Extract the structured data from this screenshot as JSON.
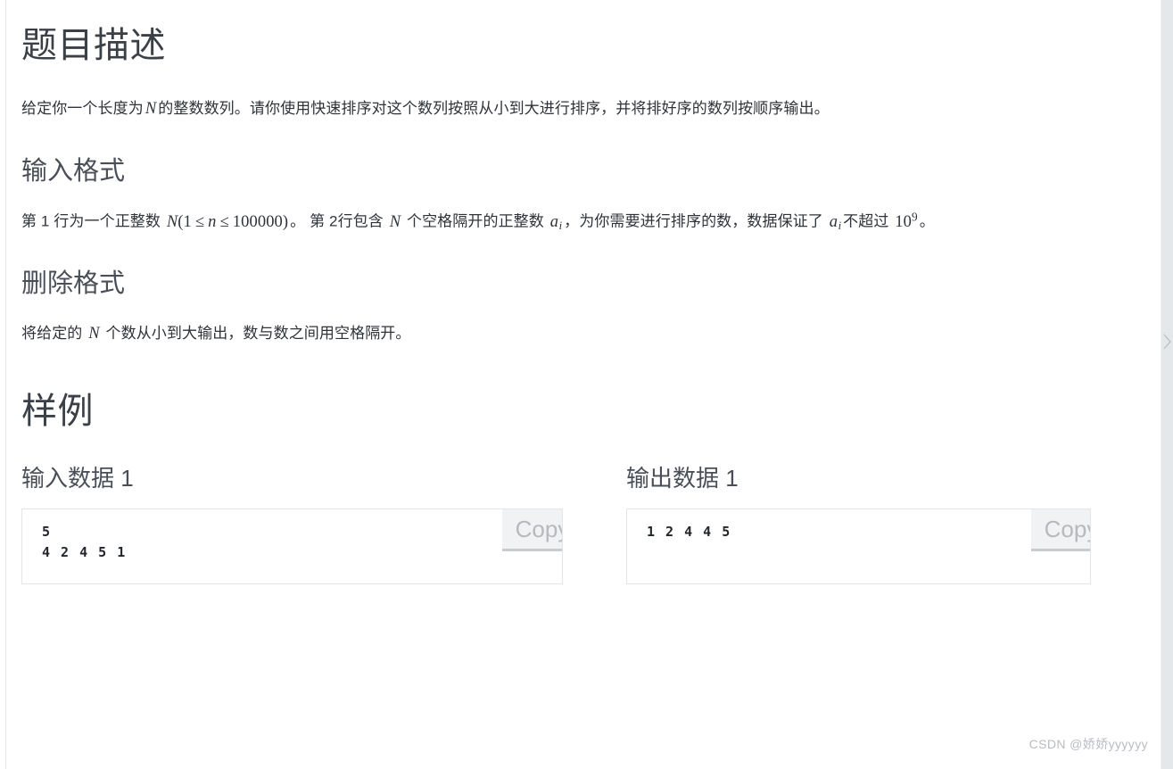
{
  "document": {
    "title": "题目描述",
    "description": {
      "prefix": "给定你一个长度为",
      "var_n": "N",
      "suffix": "的整数数列。请你使用快速排序对这个数列按照从小到大进行排序，并将排好序的数列按顺序输出。"
    },
    "sections": [
      {
        "heading": "输入格式",
        "text_1": "第 1 行为一个正整数 ",
        "math_1": "N(1 ≤ n ≤ 100000)",
        "text_2": "。 第 2行包含 ",
        "math_2": "N",
        "text_3": " 个空格隔开的正整数 ",
        "math_3": "a_i",
        "text_4": "，为你需要进行排序的数，数据保证了 ",
        "math_4": "a_i",
        "text_5": "不超过 ",
        "math_5": "10^9",
        "text_6": "。"
      },
      {
        "heading": "删除格式",
        "text_1": "将给定的 ",
        "math_1": "N",
        "text_2": " 个数从小到大输出，数与数之间用空格隔开。"
      }
    ],
    "sample": {
      "title": "样例",
      "input": {
        "heading": "输入数据 1",
        "code": "5\n4 2 4 5 1",
        "copy_label": "Copy"
      },
      "output": {
        "heading": "输出数据 1",
        "code": "1 2 4 4 5",
        "copy_label": "Copy"
      }
    },
    "math_symbols": {
      "n_upper": "N",
      "n_lower": "n",
      "one": "1",
      "limit": "100000",
      "le": "≤",
      "a": "a",
      "i": "i",
      "ten": "10",
      "nine": "9",
      "paren_open": "(",
      "paren_close": ")"
    },
    "watermark": "CSDN @娇娇yyyyyy",
    "colors": {
      "text": "#2c3038",
      "heading": "#3b3f46",
      "border": "#e3e5e8",
      "copy_bg": "#f1f2f3",
      "copy_text": "#b6b9bd",
      "watermark": "#b9bcc0",
      "panel": "#e4e8eb"
    }
  }
}
